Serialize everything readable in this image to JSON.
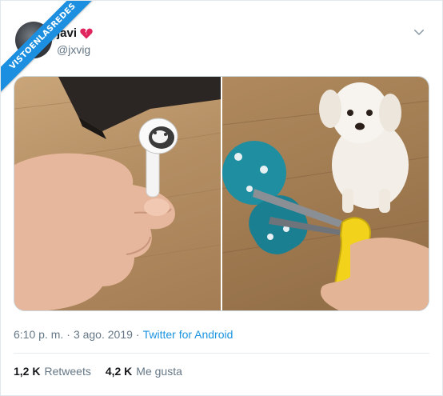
{
  "watermark": {
    "text": "VISTOENLASREDES"
  },
  "tweet": {
    "display_name": "javi",
    "name_emoji": "broken-heart-emoji",
    "handle": "@jxvig",
    "time": "6:10 p. m.",
    "separator": "·",
    "date": "3 ago. 2019",
    "source": "Twitter for Android",
    "retweets_count": "1,2 K",
    "retweets_label": "Retweets",
    "likes_count": "4,2 K",
    "likes_label": "Me gusta"
  },
  "icons": {
    "menu": "chevron-down-icon",
    "heart": "broken-heart-icon"
  },
  "colors": {
    "link": "#1b95e0",
    "muted": "#657786",
    "text": "#14171a",
    "ribbon": "#1d8fe0",
    "heart": "#e0245e"
  }
}
